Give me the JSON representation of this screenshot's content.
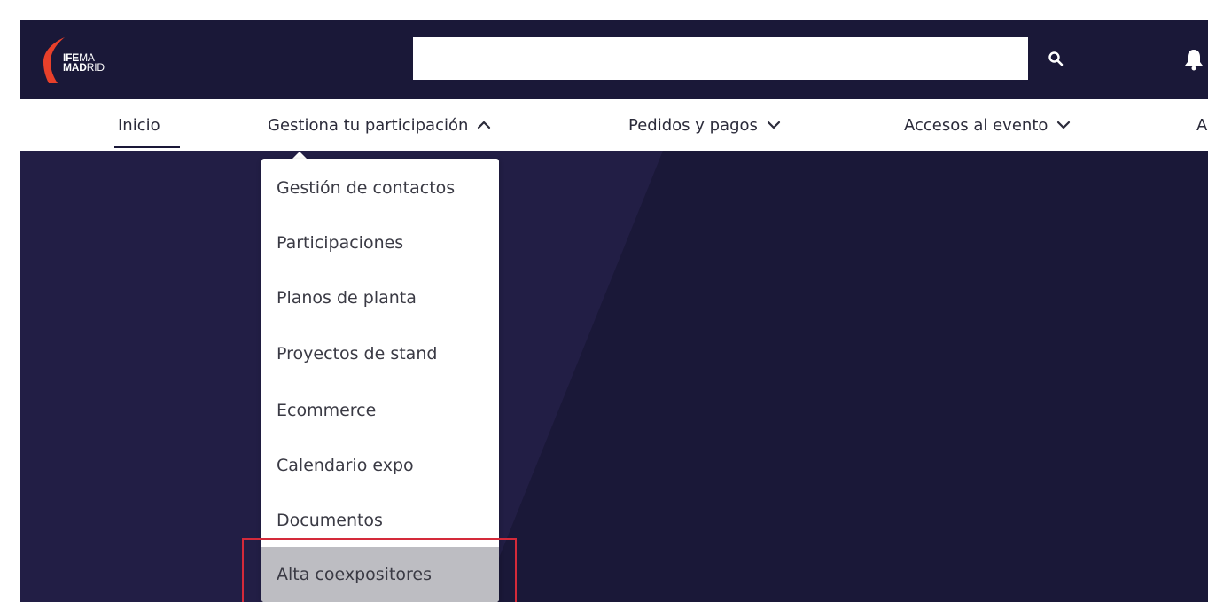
{
  "brand": {
    "logo_top_bold": "IFE",
    "logo_top_light": "MA",
    "logo_bottom_bold": "MAD",
    "logo_bottom_light": "RID",
    "accent_color": "#e8402a"
  },
  "header": {
    "search": {
      "value": "",
      "placeholder": ""
    },
    "search_icon": "search-icon",
    "bell_icon": "bell-icon",
    "background_color": "#1a1838"
  },
  "nav": {
    "items": [
      {
        "label": "Inicio",
        "active": true
      },
      {
        "label": "Gestiona tu participación",
        "expanded": true,
        "icon": "chevron-up-icon"
      },
      {
        "label": "Pedidos y pagos",
        "icon": "chevron-down-icon"
      },
      {
        "label": "Accesos al evento",
        "icon": "chevron-down-icon"
      },
      {
        "label": "A"
      }
    ]
  },
  "dropdown": {
    "items": [
      {
        "label": "Gestión de contactos"
      },
      {
        "label": "Participaciones"
      },
      {
        "label": "Planos de planta"
      },
      {
        "label": "Proyectos de stand"
      },
      {
        "label": "Ecommerce"
      },
      {
        "label": "Calendario expo"
      },
      {
        "label": "Documentos"
      },
      {
        "label": "Alta coexpositores",
        "selected": true
      }
    ]
  },
  "annotation": {
    "highlight_color": "#d42a3a"
  }
}
